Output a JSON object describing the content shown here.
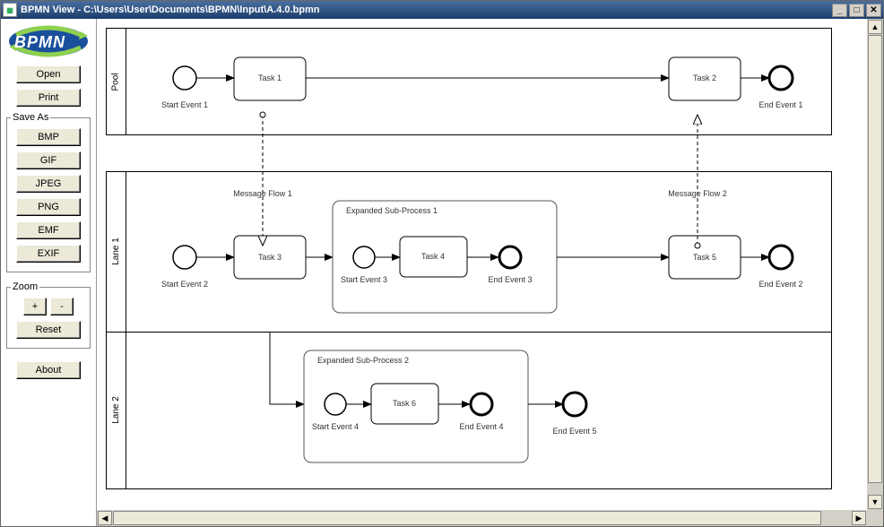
{
  "window": {
    "title": "BPMN View - C:\\Users\\User\\Documents\\BPMN\\Input\\A.4.0.bpmn"
  },
  "logo_text": "BPMN",
  "buttons": {
    "open": "Open",
    "print": "Print",
    "bmp": "BMP",
    "gif": "GIF",
    "jpeg": "JPEG",
    "png": "PNG",
    "emf": "EMF",
    "exif": "EXIF",
    "zoom_in": "+",
    "zoom_out": "-",
    "reset": "Reset",
    "about": "About"
  },
  "groups": {
    "saveas": "Save As",
    "zoom": "Zoom"
  },
  "diagram": {
    "pool1": {
      "name": "Pool",
      "start1": "Start Event 1",
      "task1": "Task 1",
      "task2": "Task 2",
      "end1": "End Event 1"
    },
    "pool2": {
      "lane1": {
        "name": "Lane 1",
        "start2": "Start Event 2",
        "task3": "Task 3",
        "sub1": "Expanded Sub-Process 1",
        "start3": "Start Event 3",
        "task4": "Task 4",
        "end3": "End Event 3",
        "task5": "Task 5",
        "end2": "End Event 2"
      },
      "lane2": {
        "name": "Lane 2",
        "sub2": "Expanded Sub-Process 2",
        "start4": "Start Event 4",
        "task6": "Task 6",
        "end4": "End Event 4",
        "end5": "End Event 5"
      }
    },
    "msg1": "Message Flow 1",
    "msg2": "Message Flow 2"
  }
}
